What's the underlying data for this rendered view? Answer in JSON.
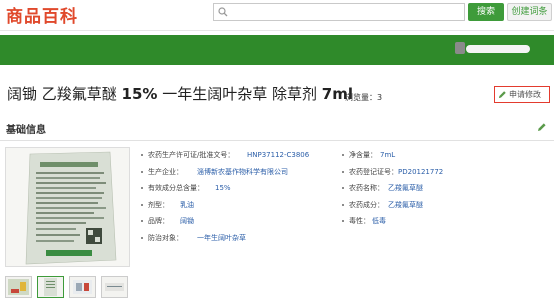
{
  "header": {
    "logo": "商品百科",
    "search_placeholder": "",
    "search_button": "搜索",
    "create_button": "创建词条"
  },
  "title": {
    "parts": [
      "阔锄 乙羧氟草醚 ",
      "15%",
      " 一年生阔叶杂草 除草剂 ",
      "7ml"
    ],
    "browse_label": "浏览量：",
    "browse_count": "3",
    "apply_edit": "申请修改"
  },
  "section": {
    "title": "基础信息"
  },
  "info_left": [
    {
      "label": "农药生产许可证/批准文号：",
      "value": "HNP37112-C3806"
    },
    {
      "label": "生产企业：",
      "value": "淄博新农基作物科学有限公司"
    },
    {
      "label": "有效成分总含量：",
      "value": "15%"
    },
    {
      "label": "剂型：",
      "value": "乳油"
    },
    {
      "label": "品牌：",
      "value": "阔锄"
    },
    {
      "label": "防治对象：",
      "value": "一年生阔叶杂草"
    }
  ],
  "info_right": [
    {
      "label": "净含量：",
      "value": "7mL"
    },
    {
      "label": "农药登记证号：",
      "value": "PD20121772"
    },
    {
      "label": "农药名称：",
      "value": "乙羧氟草醚"
    },
    {
      "label": "农药成分：",
      "value": "乙羧氟草醚"
    },
    {
      "label": "毒性：",
      "value": "低毒"
    }
  ],
  "colors": {
    "brand_green": "#2f8a2a",
    "logo_red": "#e0492c",
    "link_blue": "#2b5ea8",
    "edit_border": "#e33b2e"
  },
  "icons": {
    "search": "search-icon",
    "pen": "pen-icon"
  }
}
